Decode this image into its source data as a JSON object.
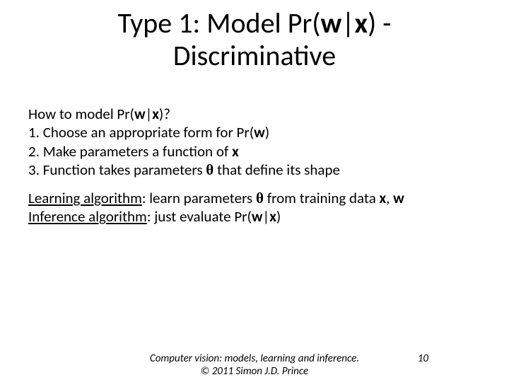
{
  "title": {
    "part1": "Type 1:  Model Pr(",
    "w": "w",
    "bar": "|",
    "x": "x",
    "part2": ")  -",
    "line2": "Discriminative"
  },
  "body": {
    "q_pre": "How to model Pr(",
    "q_w": "w",
    "q_bar": "|",
    "q_x": "x",
    "q_post": ")?",
    "s1_pre": "1. Choose an appropriate form for Pr(",
    "s1_w": "w",
    "s1_post": ")",
    "s2_pre": "2. Make parameters a function of ",
    "s2_x": "x",
    "s3_pre": "3. Function takes parameters ",
    "s3_theta": "θ",
    "s3_post": " that define its shape",
    "learn_label": "Learning algorithm",
    "learn_mid1": ":  learn parameters ",
    "learn_theta": "θ",
    "learn_mid2": " from training data ",
    "learn_x": "x",
    "learn_comma": ", ",
    "learn_w": "w",
    "inf_label": "Inference algorithm",
    "inf_mid": ":  just evaluate Pr(",
    "inf_w": "w",
    "inf_bar": "|",
    "inf_x": "x",
    "inf_post": ")"
  },
  "footer": {
    "line1": "Computer vision: models, learning and inference.",
    "line2": "© 2011 Simon J.D. Prince",
    "pagenum": "10"
  }
}
